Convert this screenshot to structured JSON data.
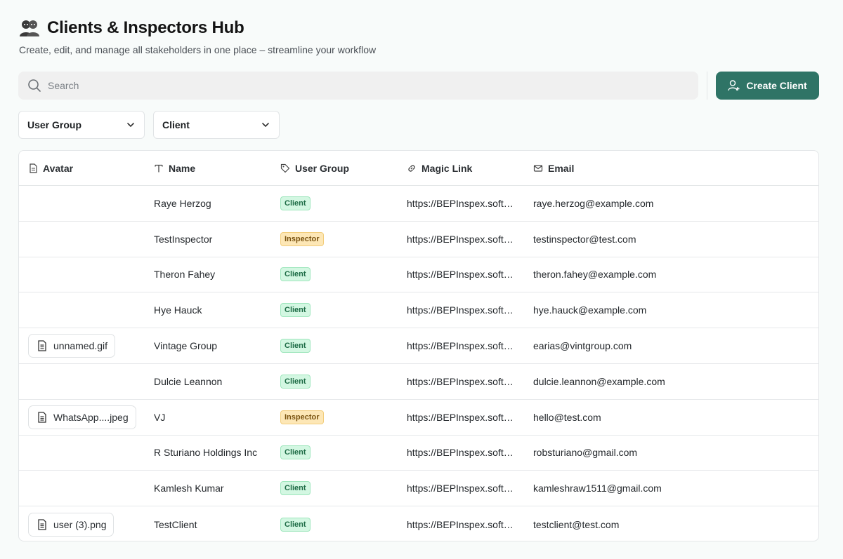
{
  "header": {
    "title": "Clients & Inspectors Hub",
    "subtitle": "Create, edit, and manage all stakeholders in one place – streamline your workflow",
    "title_icon": "people-emoji-icon"
  },
  "search": {
    "placeholder": "Search"
  },
  "create_button": {
    "label": "Create Client"
  },
  "filters": {
    "user_group": "User Group",
    "client": "Client"
  },
  "table": {
    "columns": {
      "avatar": "Avatar",
      "name": "Name",
      "user_group": "User Group",
      "magic_link": "Magic Link",
      "email": "Email"
    },
    "rows": [
      {
        "avatar": "",
        "name": "Raye Herzog",
        "group": "Client",
        "link": "https://BEPInspex.soft…",
        "email": "raye.herzog@example.com"
      },
      {
        "avatar": "",
        "name": "TestInspector",
        "group": "Inspector",
        "link": "https://BEPInspex.soft…",
        "email": "testinspector@test.com"
      },
      {
        "avatar": "",
        "name": "Theron Fahey",
        "group": "Client",
        "link": "https://BEPInspex.soft…",
        "email": "theron.fahey@example.com"
      },
      {
        "avatar": "",
        "name": "Hye Hauck",
        "group": "Client",
        "link": "https://BEPInspex.soft…",
        "email": "hye.hauck@example.com"
      },
      {
        "avatar": "unnamed.gif",
        "name": "Vintage Group",
        "group": "Client",
        "link": "https://BEPInspex.soft…",
        "email": "earias@vintgroup.com"
      },
      {
        "avatar": "",
        "name": "Dulcie Leannon",
        "group": "Client",
        "link": "https://BEPInspex.soft…",
        "email": "dulcie.leannon@example.com"
      },
      {
        "avatar": "WhatsApp....jpeg",
        "name": "VJ",
        "group": "Inspector",
        "link": "https://BEPInspex.soft…",
        "email": "hello@test.com"
      },
      {
        "avatar": "",
        "name": "R Sturiano Holdings Inc",
        "group": "Client",
        "link": "https://BEPInspex.soft…",
        "email": "robsturiano@gmail.com"
      },
      {
        "avatar": "",
        "name": "Kamlesh Kumar",
        "group": "Client",
        "link": "https://BEPInspex.soft…",
        "email": "kamleshraw1511@gmail.com"
      },
      {
        "avatar": "user (3).png",
        "name": "TestClient",
        "group": "Client",
        "link": "https://BEPInspex.soft…",
        "email": "testclient@test.com"
      }
    ]
  },
  "colors": {
    "primary": "#2f7466",
    "client_badge_bg": "#d3f7e2",
    "inspector_badge_bg": "#fde7b6"
  }
}
